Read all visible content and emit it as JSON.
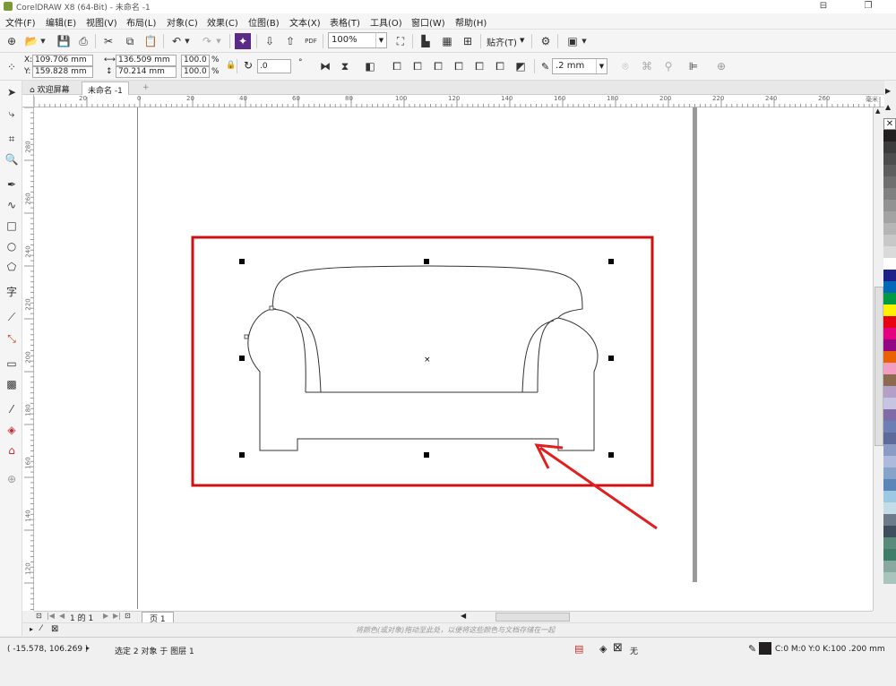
{
  "window": {
    "title": "CorelDRAW X8 (64-Bit) - 未命名 -1"
  },
  "menubar": {
    "items": [
      "文件(F)",
      "编辑(E)",
      "视图(V)",
      "布局(L)",
      "对象(C)",
      "效果(C)",
      "位图(B)",
      "文本(X)",
      "表格(T)",
      "工具(O)",
      "窗口(W)",
      "帮助(H)"
    ]
  },
  "toolbar": {
    "zoom_value": "100%",
    "snap_label": "贴齐(T)",
    "pdf_label": "PDF"
  },
  "propbar": {
    "x_label": "X:",
    "x_value": "109.706 mm",
    "y_label": "Y:",
    "y_value": "159.828 mm",
    "w_value": "136.509 mm",
    "h_value": "70.214 mm",
    "scale_w": "100.0",
    "scale_h": "100.0",
    "percent": "%",
    "rotation": ".0",
    "degree": "°",
    "outline_width": ".2 mm"
  },
  "tabs": {
    "welcome": "欢迎屏幕",
    "document": "未命名 -1",
    "add": "+"
  },
  "ruler": {
    "h_ticks": [
      "20",
      "0",
      "20",
      "40",
      "60",
      "80",
      "100",
      "120",
      "140",
      "160",
      "180",
      "200",
      "220",
      "240",
      "260"
    ],
    "h_unit": "毫米",
    "v_ticks": [
      "280",
      "260",
      "240",
      "220",
      "200",
      "180",
      "160",
      "140",
      "120",
      "100",
      "80"
    ]
  },
  "pagenav": {
    "page_indicator": "1 的 1",
    "page_tab": "页 1"
  },
  "hint": {
    "text": "将颜色(或对象)拖动至此处，以便将这些颜色与文档存储在一起"
  },
  "status": {
    "coords": "( -15.578, 106.269 )",
    "selection": "选定 2 对象 于 图层 1",
    "fill_none": "无",
    "color_info": "C:0 M:0 Y:0 K:100  .200 mm"
  },
  "palette": {
    "colors": [
      "#ffffff",
      "#231f20",
      "#3c3c3c",
      "#4d4d4d",
      "#5e5e5e",
      "#6f6f6f",
      "#808080",
      "#929292",
      "#a3a3a3",
      "#b5b5b5",
      "#c8c8c8",
      "#dadada",
      "#ffffff",
      "#1d2088",
      "#0068b7",
      "#009944",
      "#fff100",
      "#e60012",
      "#e4007f",
      "#920783",
      "#eb6100",
      "#f19ec2",
      "#8c6a4f",
      "#b3a0c8",
      "#c7c4e2",
      "#7e6ca8",
      "#6c7fb5",
      "#5c6b9a",
      "#8a9cc4",
      "#aebadb",
      "#86a4c9",
      "#5a87b7",
      "#9dc8e4",
      "#c4dbe8",
      "#6b7b8b",
      "#3d4f5c",
      "#5a8a7a",
      "#3f7d6b",
      "#88a9a0",
      "#a9c3bd"
    ]
  },
  "colors": {
    "selection_frame": "#d01010",
    "arrow": "#e02020"
  }
}
